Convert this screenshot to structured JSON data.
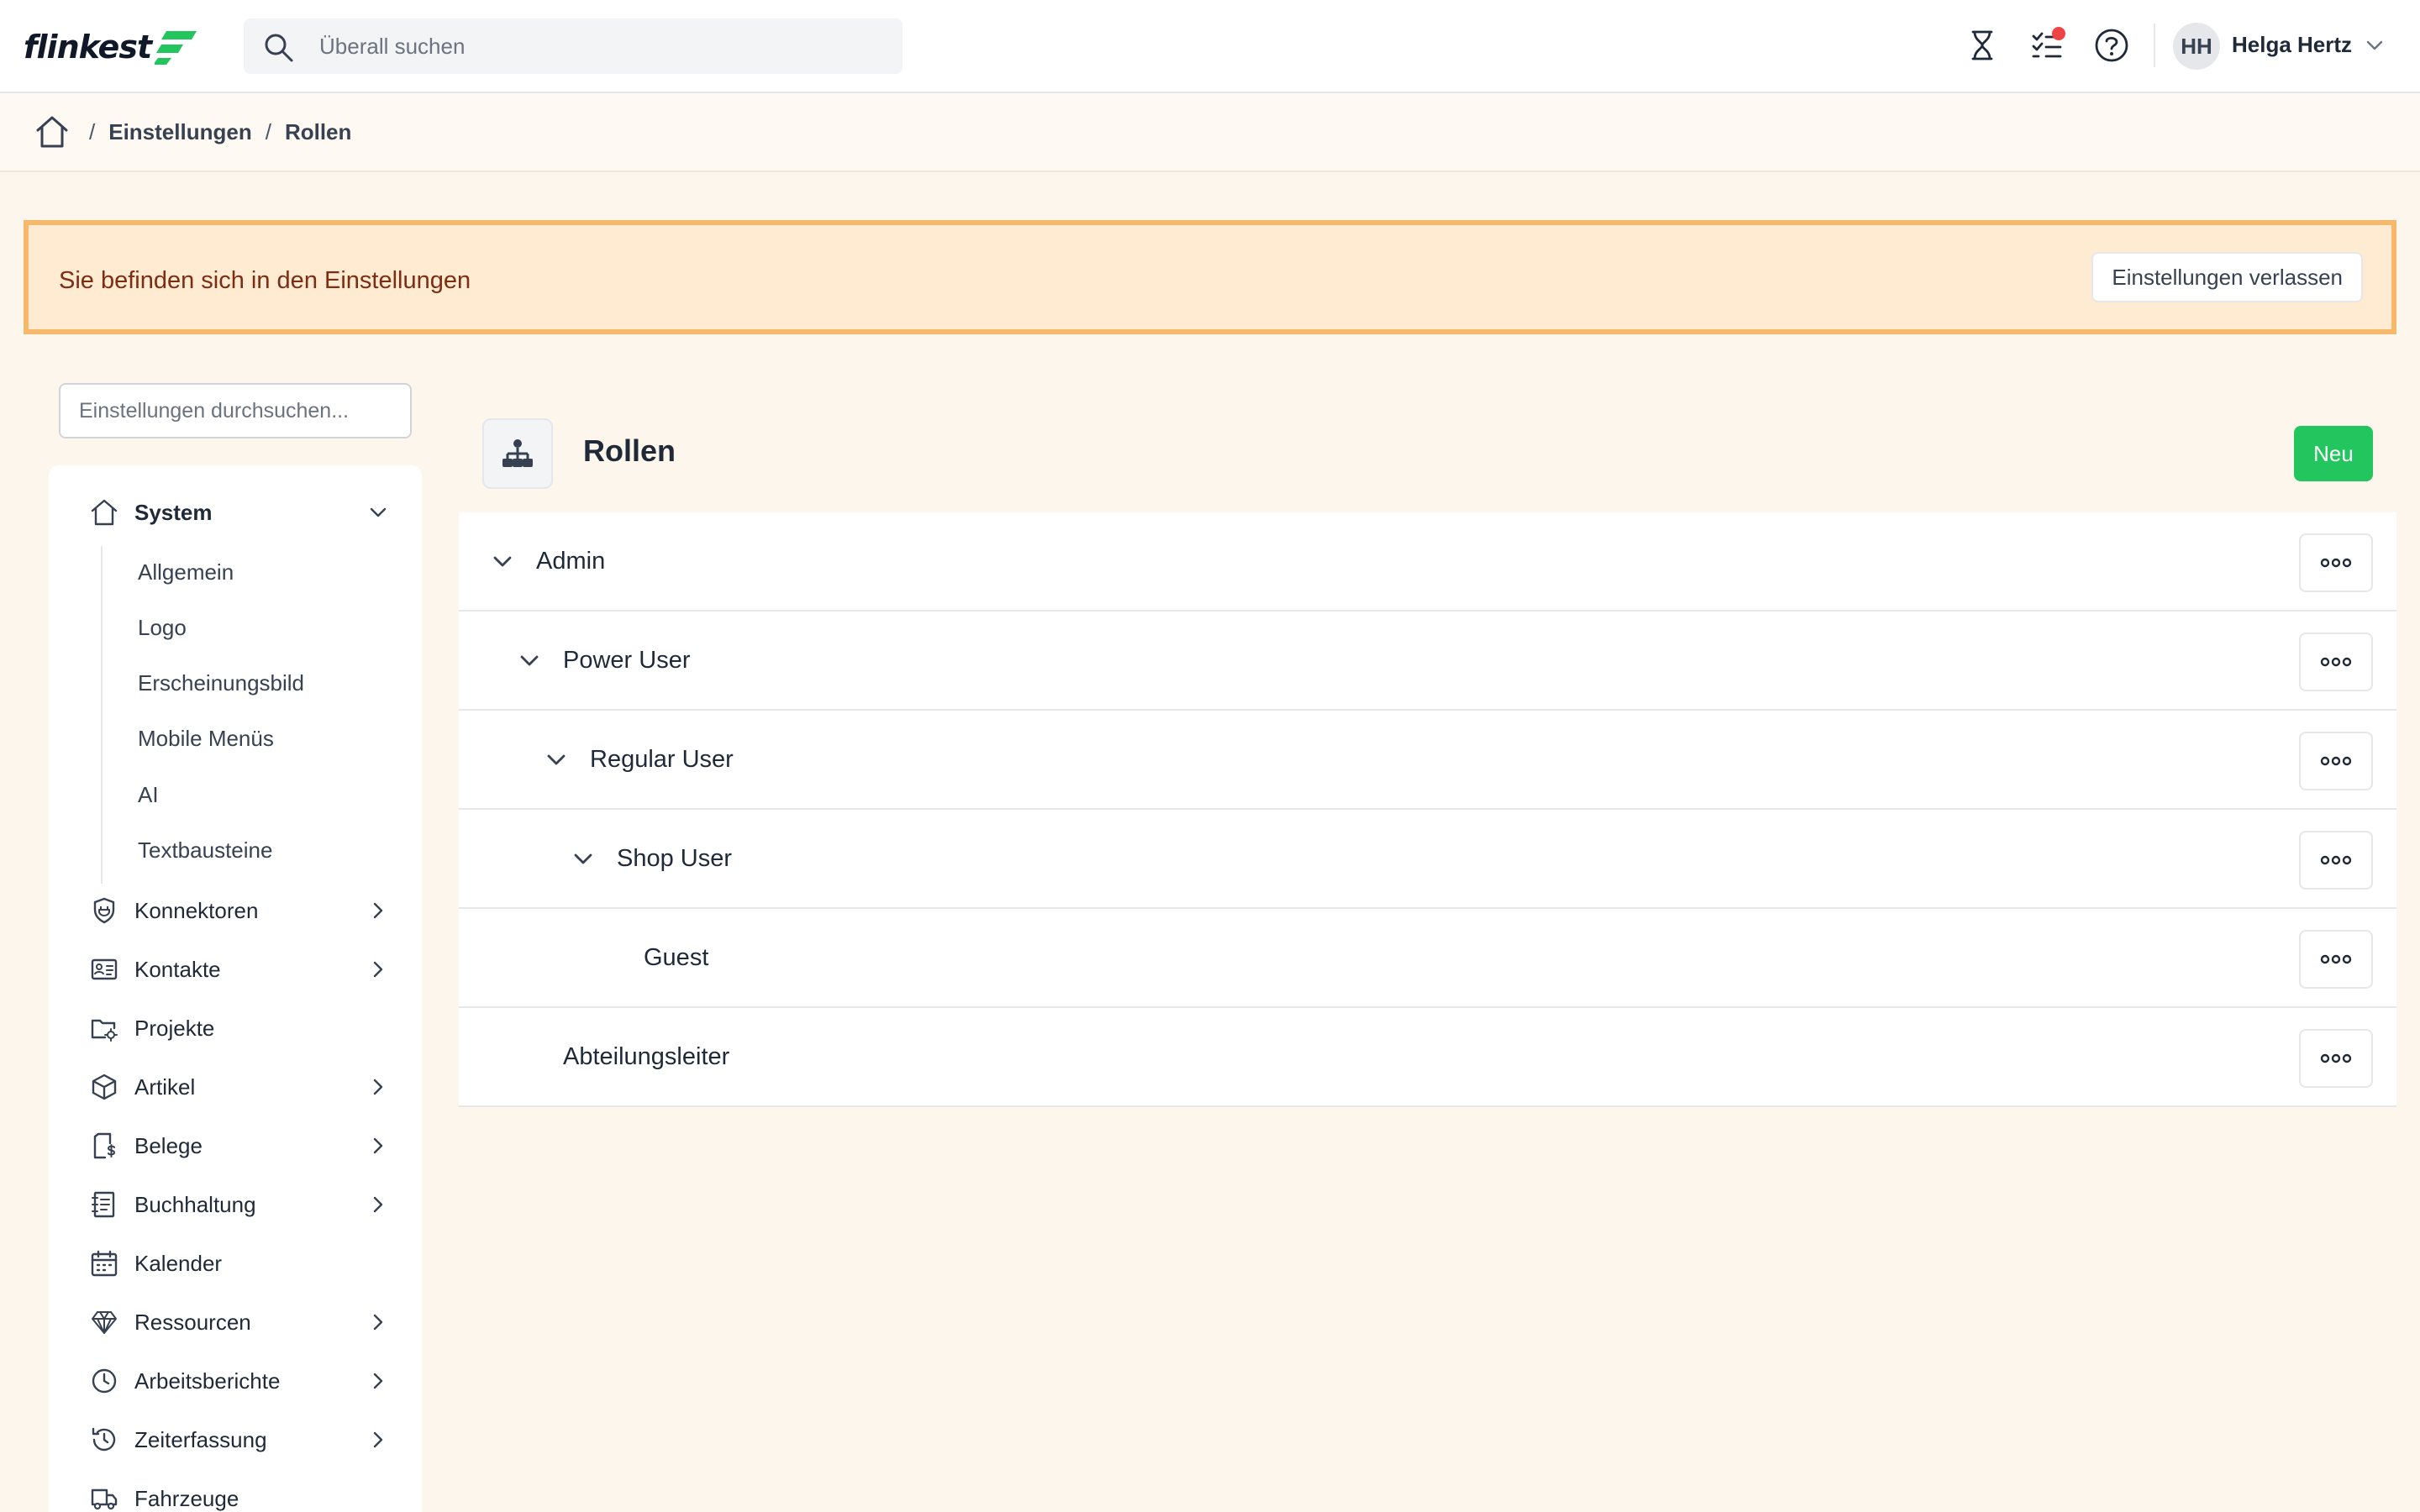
{
  "header": {
    "logo_text": "flinkest",
    "search_placeholder": "Überall suchen",
    "icons": [
      "hourglass-icon",
      "tasks-icon",
      "help-icon"
    ],
    "user": {
      "initials": "HH",
      "name": "Helga Hertz"
    }
  },
  "breadcrumb": {
    "items": [
      "Einstellungen",
      "Rollen"
    ]
  },
  "banner": {
    "text": "Sie befinden sich in den Einstellungen",
    "button": "Einstellungen verlassen"
  },
  "sidebar": {
    "search_placeholder": "Einstellungen durchsuchen...",
    "system": {
      "label": "System",
      "items": [
        "Allgemein",
        "Logo",
        "Erscheinungsbild",
        "Mobile Menüs",
        "AI",
        "Textbausteine"
      ]
    },
    "items": [
      {
        "label": "Konnektoren",
        "icon": "plug-shield-icon",
        "has_children": true
      },
      {
        "label": "Kontakte",
        "icon": "contact-card-icon",
        "has_children": true
      },
      {
        "label": "Projekte",
        "icon": "folder-gear-icon",
        "has_children": false
      },
      {
        "label": "Artikel",
        "icon": "box-icon",
        "has_children": true
      },
      {
        "label": "Belege",
        "icon": "receipt-dollar-icon",
        "has_children": true
      },
      {
        "label": "Buchhaltung",
        "icon": "ledger-icon",
        "has_children": true
      },
      {
        "label": "Kalender",
        "icon": "calendar-icon",
        "has_children": false
      },
      {
        "label": "Ressourcen",
        "icon": "diamond-icon",
        "has_children": true
      },
      {
        "label": "Arbeitsberichte",
        "icon": "clock-icon",
        "has_children": true
      },
      {
        "label": "Zeiterfassung",
        "icon": "history-clock-icon",
        "has_children": true
      },
      {
        "label": "Fahrzeuge",
        "icon": "truck-icon",
        "has_children": false
      }
    ]
  },
  "main": {
    "title": "Rollen",
    "new_button": "Neu",
    "roles": [
      {
        "label": "Admin",
        "level": 0,
        "expanded": true
      },
      {
        "label": "Power User",
        "level": 1,
        "expanded": true
      },
      {
        "label": "Regular User",
        "level": 2,
        "expanded": true
      },
      {
        "label": "Shop User",
        "level": 3,
        "expanded": true
      },
      {
        "label": "Guest",
        "level": 4,
        "expanded": false,
        "leaf": true
      },
      {
        "label": "Abteilungsleiter",
        "level": 1,
        "expanded": false,
        "leaf": true
      }
    ]
  },
  "colors": {
    "accent_green": "#22c55e",
    "banner_bg": "#ffead2",
    "banner_border": "#f6b86a",
    "page_bg": "#fdf6ec",
    "notification": "#ef4444"
  }
}
